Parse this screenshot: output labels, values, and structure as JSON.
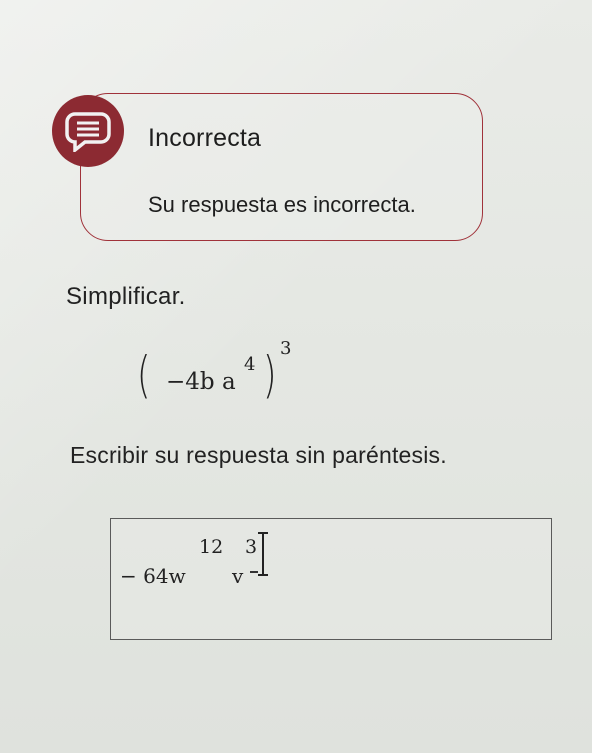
{
  "feedback": {
    "status_title": "Incorrecta",
    "message": "Su respuesta es incorrecta.",
    "icon": "chat-bubble-icon",
    "accent_color": "#8c2a32"
  },
  "problem": {
    "instruction": "Simplificar.",
    "expression": {
      "open_paren": "(",
      "base": "−4b a",
      "inner_exponent": "4",
      "close_paren": ")",
      "outer_exponent": "3"
    },
    "answer_instruction": "Escribir su respuesta sin paréntesis."
  },
  "answer": {
    "coefficient": "− 64w",
    "exponent_w": "12",
    "variable_v": "v",
    "exponent_v": "3"
  }
}
